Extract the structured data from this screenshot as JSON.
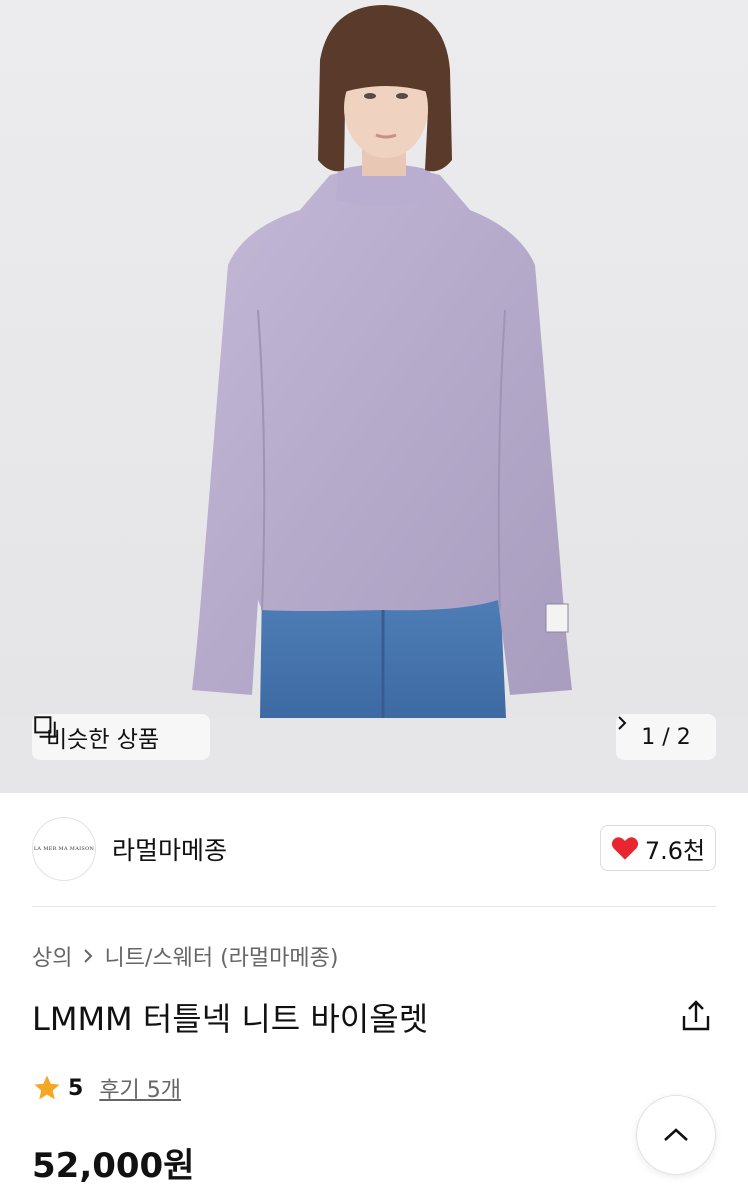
{
  "gallery": {
    "similar_label": "비슷한 상품",
    "similar_icon": "copy-icon",
    "current": "1",
    "total": "2",
    "pager_label": "1 / 2"
  },
  "brand": {
    "name": "라멀마메종",
    "logo_text": "LA MER MA MAISON",
    "like_count": "7.6천",
    "like_icon": "heart-icon",
    "like_color": "#e8262f"
  },
  "breadcrumb": {
    "items": [
      "상의",
      "니트/스웨터 (라멀마메종)"
    ]
  },
  "product": {
    "title": "LMMM 터틀넥 니트 바이올렛",
    "rating": "5",
    "reviews": "후기 5개",
    "price": "52,000원",
    "star_color": "#f5a623"
  },
  "buttons": {
    "share_icon": "share-icon",
    "scroll_top_icon": "chevron-up-icon"
  }
}
